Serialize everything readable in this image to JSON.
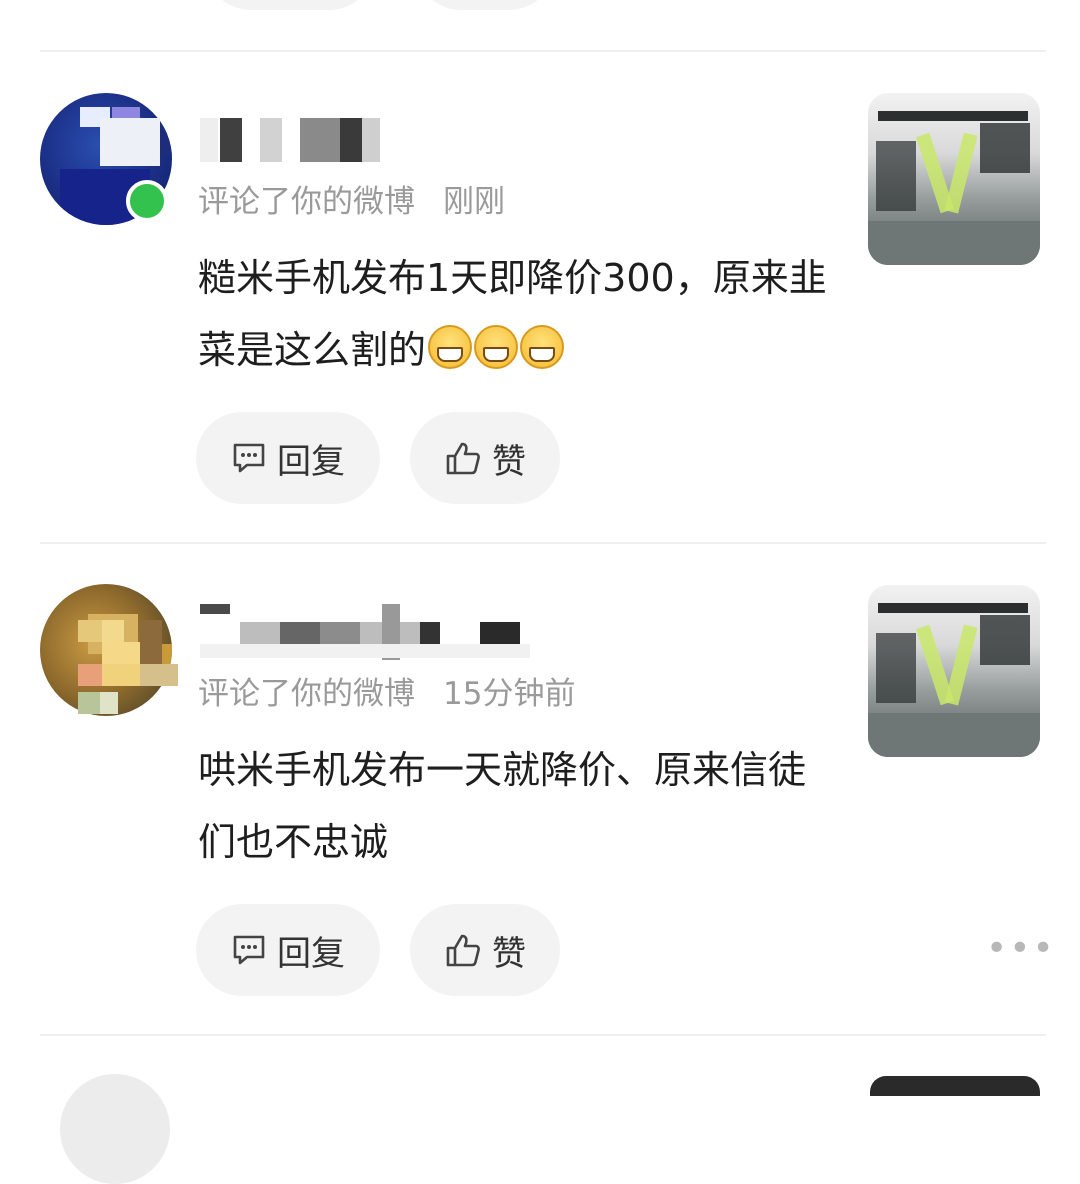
{
  "comments": [
    {
      "action": "评论了你的微博",
      "time": "刚刚",
      "text": "糙米手机发布1天即降价300，原来韭菜是这么割的",
      "emoji": "grinning-face-icon",
      "online": true
    },
    {
      "action": "评论了你的微博",
      "time": "15分钟前",
      "text": "哄米手机发布一天就降价、原来信徒们也不忠诚",
      "online": false
    }
  ],
  "actions": {
    "reply_label": "回复",
    "like_label": "赞"
  },
  "more_label": "•••",
  "colors": {
    "online_dot": "#33c24d",
    "meta_text": "#9a9a9a",
    "button_bg": "#f3f3f3"
  }
}
